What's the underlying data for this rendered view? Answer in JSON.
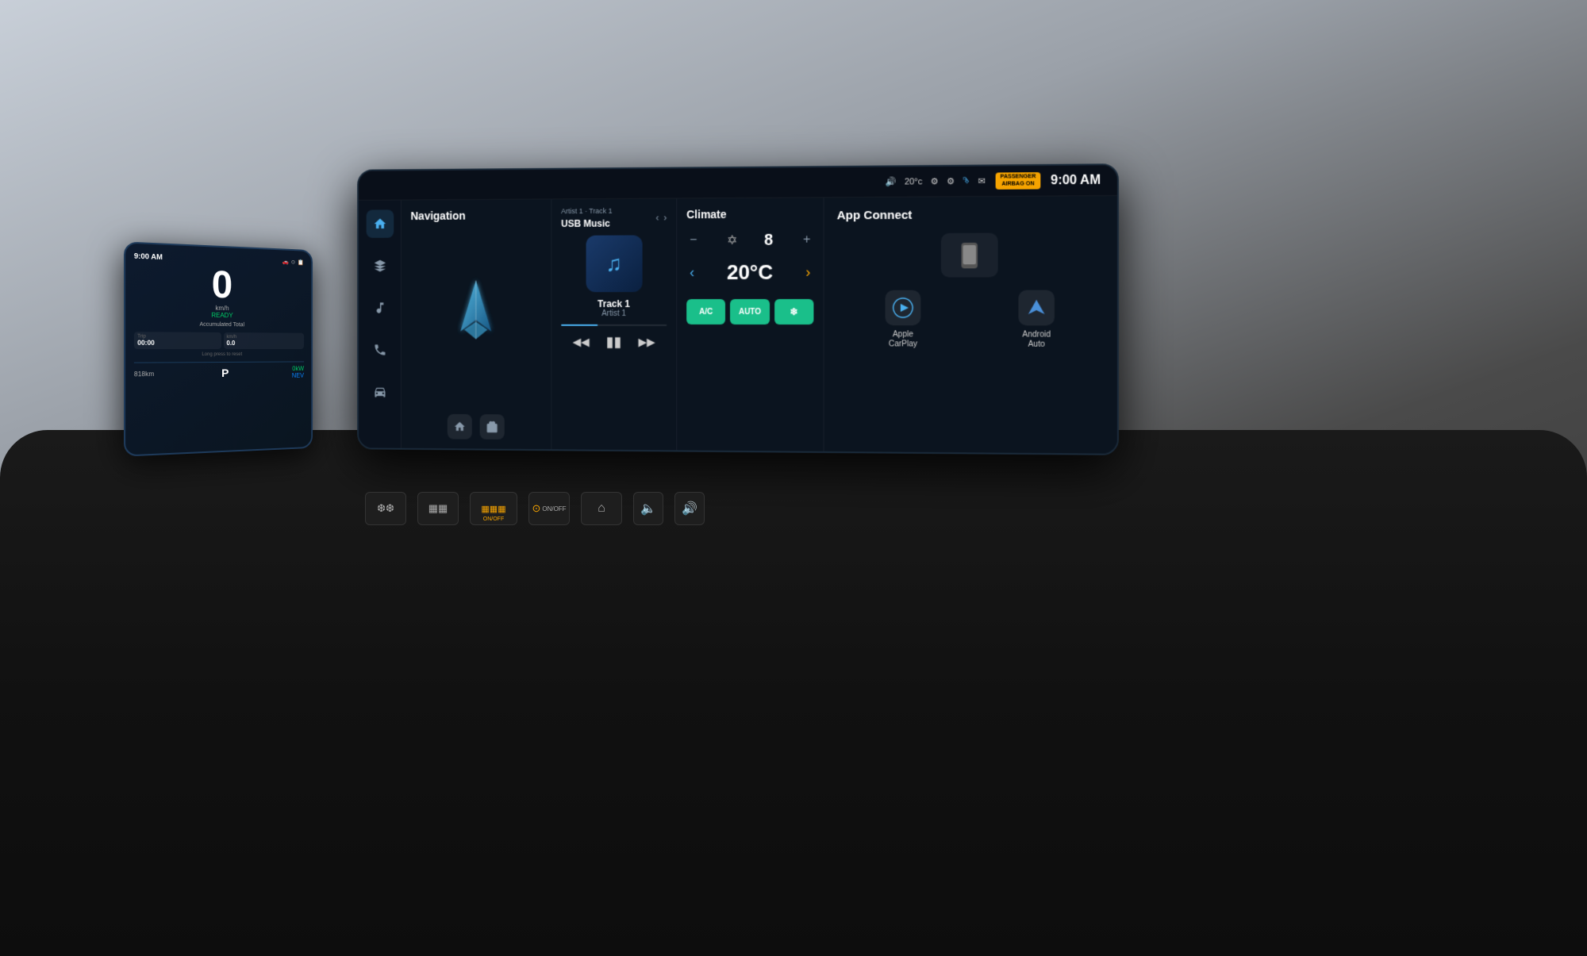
{
  "status_bar": {
    "temperature": "20°c",
    "time": "9:00 AM",
    "airbag_label": "PASSENGER\nAIRBAG ON",
    "icons": [
      "volume",
      "usb",
      "bluetooth",
      "email"
    ]
  },
  "instrument_cluster": {
    "time": "9:00 AM",
    "speed": "0",
    "speed_unit": "km/h",
    "status": "READY",
    "accumulated_total_label": "Accumulated Total",
    "trip1_label": "00:00",
    "trip2_label": "0.0",
    "distance_label": "0.0/100km",
    "long_press_label": "Long press to reset",
    "range": "818km",
    "gear": "P",
    "power_value": "0kW",
    "ev_label": "NEV"
  },
  "navigation": {
    "title": "Navigation",
    "bottom_icons": [
      "home",
      "suitcase"
    ]
  },
  "music": {
    "source": "USB Music",
    "track_name": "Track 1",
    "artist": "Artist 1",
    "source_line": "Artist 1 · Track 1",
    "progress": 35
  },
  "climate": {
    "title": "Climate",
    "fan_level": "8",
    "temperature": "20°C",
    "buttons": [
      "A/C",
      "AUTO",
      "❄"
    ],
    "ac_label": "A/C",
    "auto_label": "AUTO"
  },
  "app_connect": {
    "title": "App Connect",
    "apple_carplay_label": "Apple\nCarPlay",
    "android_auto_label": "Android\nAuto"
  },
  "sidebar": {
    "icons": [
      "home",
      "navigation",
      "music",
      "phone",
      "car"
    ]
  }
}
